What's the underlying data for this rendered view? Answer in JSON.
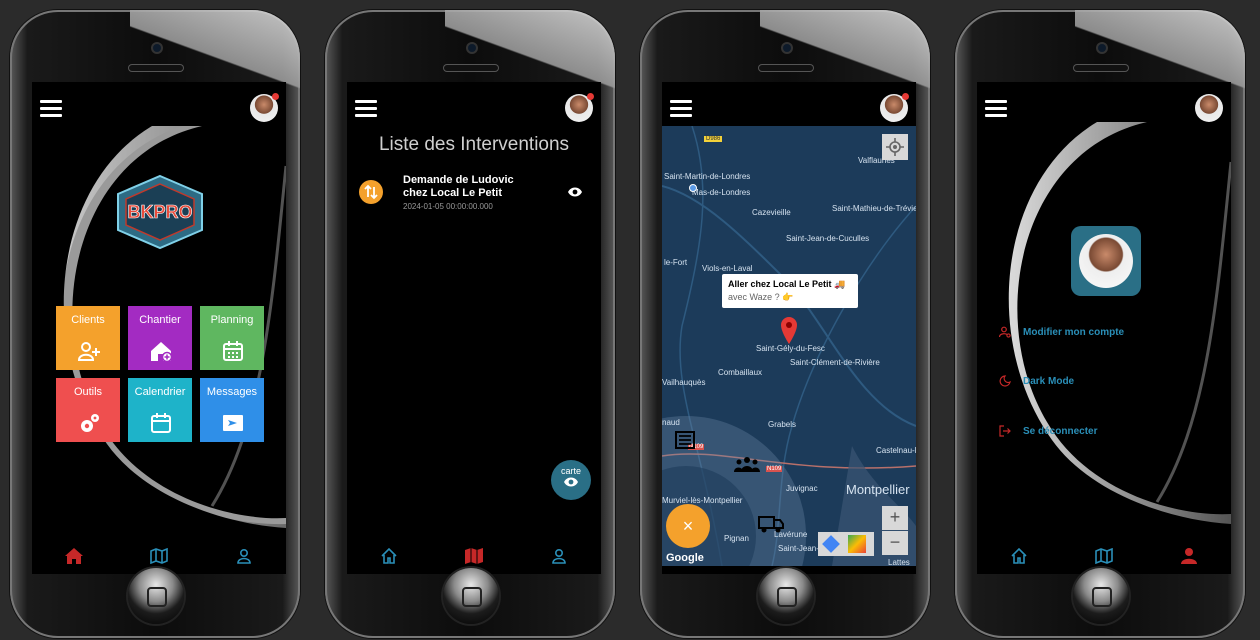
{
  "colors": {
    "accent_red": "#c62828",
    "accent_blue": "#2a8fb8",
    "orange": "#f4a12c"
  },
  "phone1": {
    "logo_text": "BKPRO",
    "tiles": [
      {
        "label": "Clients",
        "color": "#f4a12c",
        "icon": "add-user-icon"
      },
      {
        "label": "Chantier",
        "color": "#a32bc2",
        "icon": "add-house-icon"
      },
      {
        "label": "Planning",
        "color": "#5fb760",
        "icon": "calendar-icon"
      },
      {
        "label": "Outils",
        "color": "#ef4f4f",
        "icon": "gears-icon"
      },
      {
        "label": "Calendrier",
        "color": "#1eb3c9",
        "icon": "calendar-icon"
      },
      {
        "label": "Messages",
        "color": "#2f8fe8",
        "icon": "message-icon"
      }
    ]
  },
  "phone2": {
    "title": "Liste des Interventions",
    "items": [
      {
        "line1": "Demande de  Ludovic",
        "line2": "chez Local Le Petit",
        "date": "2024-01-05 00:00:00.000"
      }
    ],
    "fab_label": "carte"
  },
  "phone3": {
    "places": [
      "D986",
      "Valflaunès",
      "Saint-Martin-de-Londres",
      "Mas-de-Londres",
      "Cazevieille",
      "Saint-Mathieu-de-Tréviers",
      "Saint-Jean-de-Cuculles",
      "le-Fort",
      "Viols-en-Laval",
      "Saint-Gély-du-Fesc",
      "Saint-Clément-de-Rivière",
      "Vailhauquès",
      "Combaillaux",
      "Grabels",
      "Castelnau-le",
      "naud",
      "N109",
      "N109",
      "Juvignac",
      "Montpellier",
      "Murviel-lès-Montpellier",
      "Lavérune",
      "Pignan",
      "Saint-Jean-de-Védas",
      "Lattes"
    ],
    "tooltip_title": "Aller chez Local Le Petit 🚚",
    "tooltip_sub": "avec Waze ?  👉",
    "google": "Google",
    "fab": "×",
    "zoom_in": "+",
    "zoom_out": "−"
  },
  "phone4": {
    "menu": [
      {
        "label": "Modifier mon compte",
        "icon": "user-settings-icon"
      },
      {
        "label": "Dark Mode",
        "icon": "moon-icon"
      },
      {
        "label": "Se déconnecter",
        "icon": "logout-icon"
      }
    ]
  }
}
